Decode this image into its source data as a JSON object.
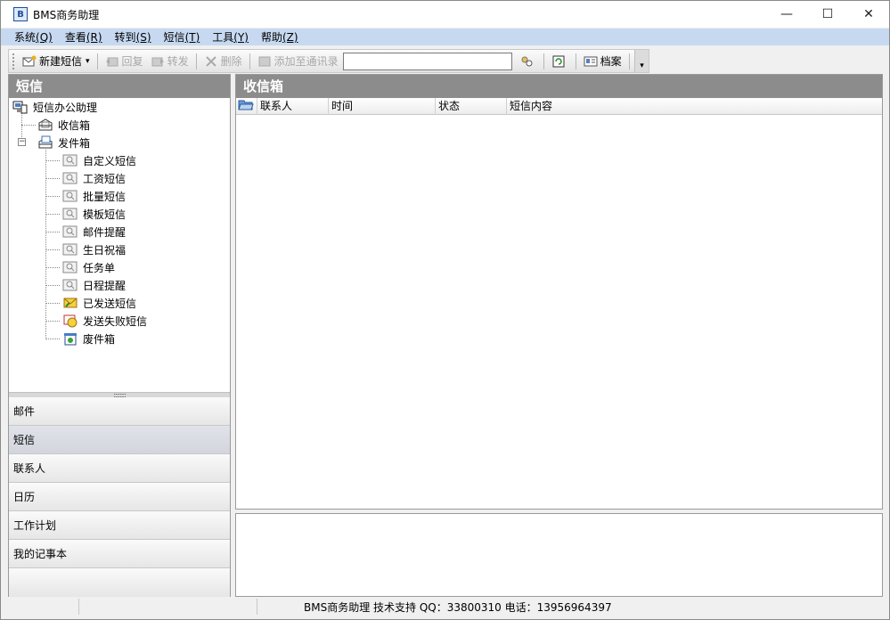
{
  "window": {
    "title": "BMS商务助理",
    "app_icon_glyph": "B",
    "controls": {
      "minimize": "—",
      "maximize": "☐",
      "close": "✕"
    }
  },
  "menu": [
    {
      "label": "系统",
      "key": "(Q)"
    },
    {
      "label": "查看",
      "key": "(R)"
    },
    {
      "label": "转到",
      "key": "(S)"
    },
    {
      "label": "短信",
      "key": "(T)"
    },
    {
      "label": "工具",
      "key": "(Y)"
    },
    {
      "label": "帮助",
      "key": "(Z)"
    }
  ],
  "toolbar": {
    "new_sms": "新建短信",
    "new_sms_dropdown": "▾",
    "reply": "回复",
    "forward": "转发",
    "delete": "删除",
    "add_to_contacts": "添加至通讯录",
    "search_value": "",
    "archive": "档案",
    "overflow": "▾"
  },
  "left_pane": {
    "header": "短信",
    "tree": {
      "root": "短信办公助理",
      "inbox": "收信箱",
      "outbox": "发件箱",
      "outbox_children": [
        "自定义短信",
        "工资短信",
        "批量短信",
        "模板短信",
        "邮件提醒",
        "生日祝福",
        "任务单",
        "日程提醒"
      ],
      "sent": "已发送短信",
      "failed": "发送失败短信",
      "trash": "废件箱"
    },
    "splitter_grip": "::::::::",
    "nav": [
      "邮件",
      "短信",
      "联系人",
      "日历",
      "工作计划",
      "我的记事本"
    ],
    "nav_active_index": 1
  },
  "right_pane": {
    "header": "收信箱",
    "columns": [
      "联系人",
      "时间",
      "状态",
      "短信内容"
    ],
    "rows": []
  },
  "statusbar": {
    "text": "BMS商务助理  技术支持  QQ：33800310  电话：13956964397"
  },
  "colors": {
    "menubar": "#c6d9f1",
    "pane_header": "#8c8c8c"
  }
}
